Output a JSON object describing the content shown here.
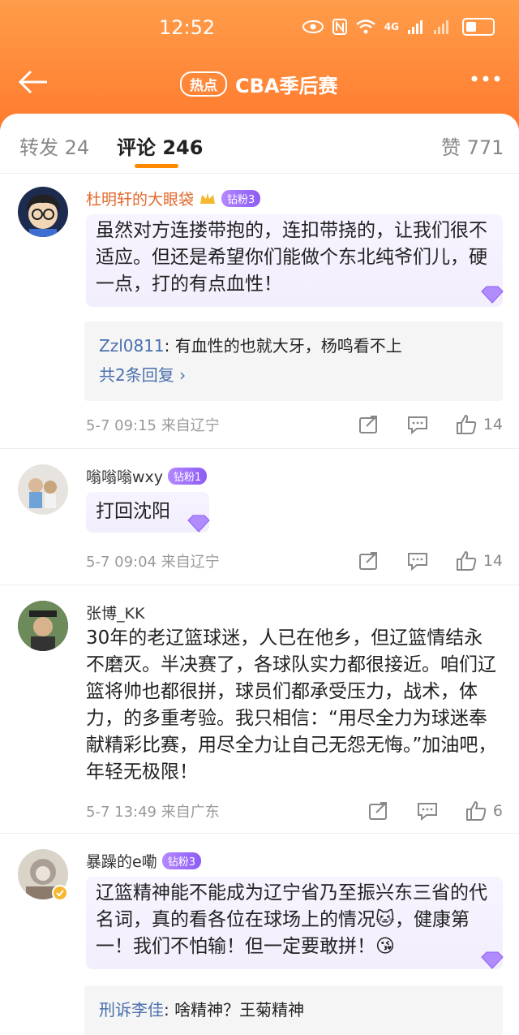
{
  "status": {
    "time": "12:52",
    "network": "4G"
  },
  "nav": {
    "badge": "热点",
    "title": "CBA季后赛"
  },
  "tabs": [
    {
      "label": "转发 24"
    },
    {
      "label": "评论 246"
    },
    {
      "label": "赞 771"
    }
  ],
  "comments": [
    {
      "name": "杜明轩的大眼袋",
      "badge": "钻粉3",
      "text": "虽然对方连搂带抱的，连扣带挠的，让我们很不适应。但还是希望你们能做个东北纯爷们儿，硬一点，打的有点血性！",
      "reply_user": "Zzl0811",
      "reply_text": ": 有血性的也就大牙，杨鸣看不上",
      "reply_more": "共2条回复 ›",
      "meta": "5-7 09:15  来自辽宁",
      "likes": "14"
    },
    {
      "name": "嗡嗡嗡wxy",
      "badge": "钻粉1",
      "text": "打回沈阳",
      "meta": "5-7 09:04  来自辽宁",
      "likes": "14"
    },
    {
      "name": "张博_KK",
      "text": "30年的老辽篮球迷，人已在他乡，但辽篮情结永不磨灭。半决赛了，各球队实力都很接近。咱们辽篮将帅也都很拼，球员们都承受压力，战术，体力，的多重考验。我只相信：“用尽全力为球迷奉献精彩比赛，用尽全力让自己无怨无悔。”加油吧，年轻无极限！",
      "meta": "5-7 13:49  来自广东",
      "likes": "6"
    },
    {
      "name": "暴躁的e嘞",
      "badge": "钻粉3",
      "text": "辽篮精神能不能成为辽宁省乃至振兴东三省的代名词，真的看各位在球场上的情况🐱，健康第一！我们不怕输！但一定要敢拼！😘",
      "reply_user": "刑诉李佳",
      "reply_text": ": 啥精神？王菊精神"
    }
  ]
}
